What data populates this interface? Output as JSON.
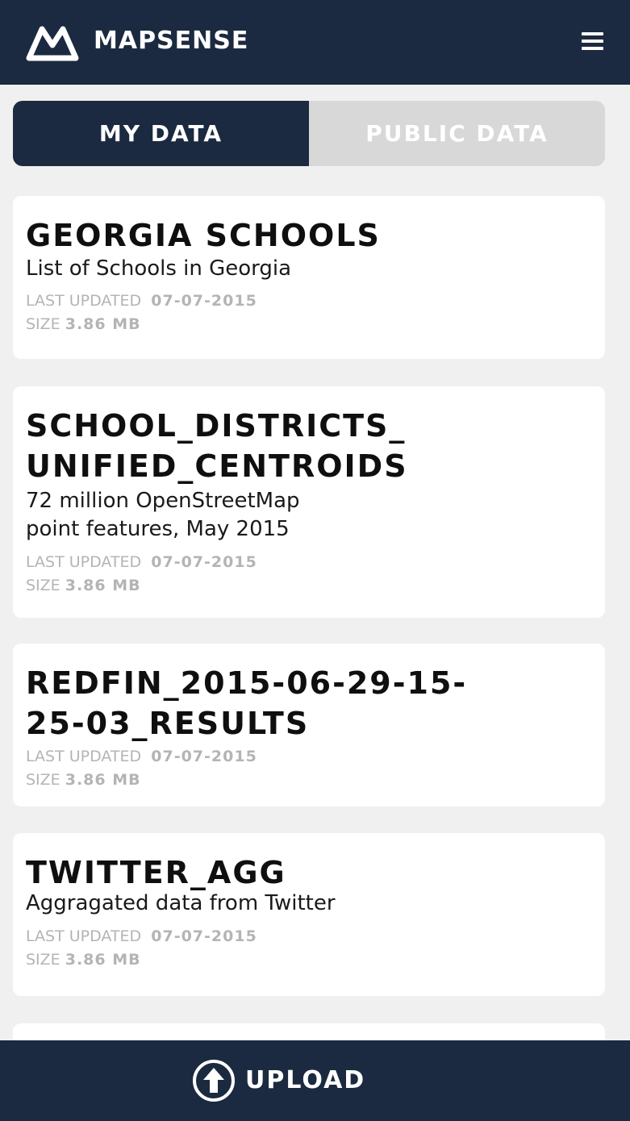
{
  "header": {
    "brand": "MAPSENSE",
    "logo_icon": "mapsense-logo-icon",
    "menu_icon": "hamburger-menu-icon",
    "bg_color": "#1b2a40"
  },
  "tabs": [
    {
      "label": "MY DATA",
      "active": true
    },
    {
      "label": "PUBLIC DATA",
      "active": false
    }
  ],
  "datasets": [
    {
      "title": "GEORGIA SCHOOLS",
      "description": "List of Schools in Georgia",
      "last_updated_label": "LAST UPDATED",
      "last_updated": "07-07-2015",
      "size_label": "SIZE",
      "size": "3.86 MB"
    },
    {
      "title": "SCHOOL_DISTRICTS_\nUNIFIED_CENTROIDS",
      "description": "72 million OpenStreetMap\npoint features, May 2015",
      "last_updated_label": "LAST UPDATED",
      "last_updated": "07-07-2015",
      "size_label": "SIZE",
      "size": "3.86 MB"
    },
    {
      "title": "REDFIN_2015-06-29-15-\n25-03_RESULTS",
      "description": "",
      "last_updated_label": "LAST UPDATED",
      "last_updated": "07-07-2015",
      "size_label": "SIZE",
      "size": "3.86 MB"
    },
    {
      "title": "TWITTER_AGG",
      "description": "Aggragated data from Twitter",
      "last_updated_label": "LAST UPDATED",
      "last_updated": "07-07-2015",
      "size_label": "SIZE",
      "size": "3.86 MB"
    }
  ],
  "footer": {
    "upload_label": "UPLOAD",
    "upload_icon": "upload-arrow-icon"
  }
}
